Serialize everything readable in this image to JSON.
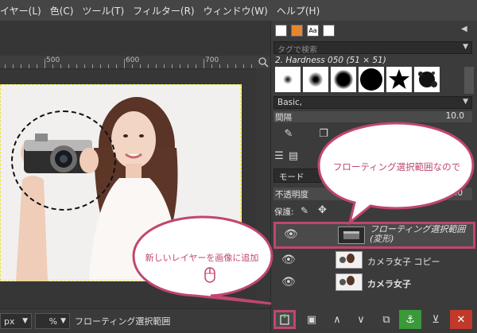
{
  "menubar": {
    "items": [
      "イヤー(L)",
      "色(C)",
      "ツール(T)",
      "フィルター(R)",
      "ウィンドウ(W)",
      "ヘルプ(H)"
    ]
  },
  "ruler": {
    "labels": [
      "500",
      "600",
      "700"
    ]
  },
  "status": {
    "unit": "px",
    "zoom_suffix": "%",
    "message": "フローティング選択範囲"
  },
  "brushes": {
    "tag_placeholder": "タグで検索",
    "current_brush": "2. Hardness 050 (51 × 51)",
    "preset": "Basic,",
    "spacing_label": "間隔",
    "spacing_value": "10.0"
  },
  "layers": {
    "mode_label": "モード",
    "opacity_label": "不透明度",
    "opacity_value": "0.0",
    "lock_label": "保護:",
    "items": [
      {
        "name": "フローティング選択範囲\n(変形)",
        "selected": true
      },
      {
        "name": "カメラ女子 コピー",
        "selected": false
      },
      {
        "name": "カメラ女子",
        "selected": false
      }
    ]
  },
  "callouts": {
    "top": "フローティング選択範囲なので",
    "bottom": "新しいレイヤーを画像に追加"
  },
  "colors": {
    "accent": "#c04670",
    "anchor_green": "#3a9a3a",
    "delete_red": "#c0392b"
  }
}
